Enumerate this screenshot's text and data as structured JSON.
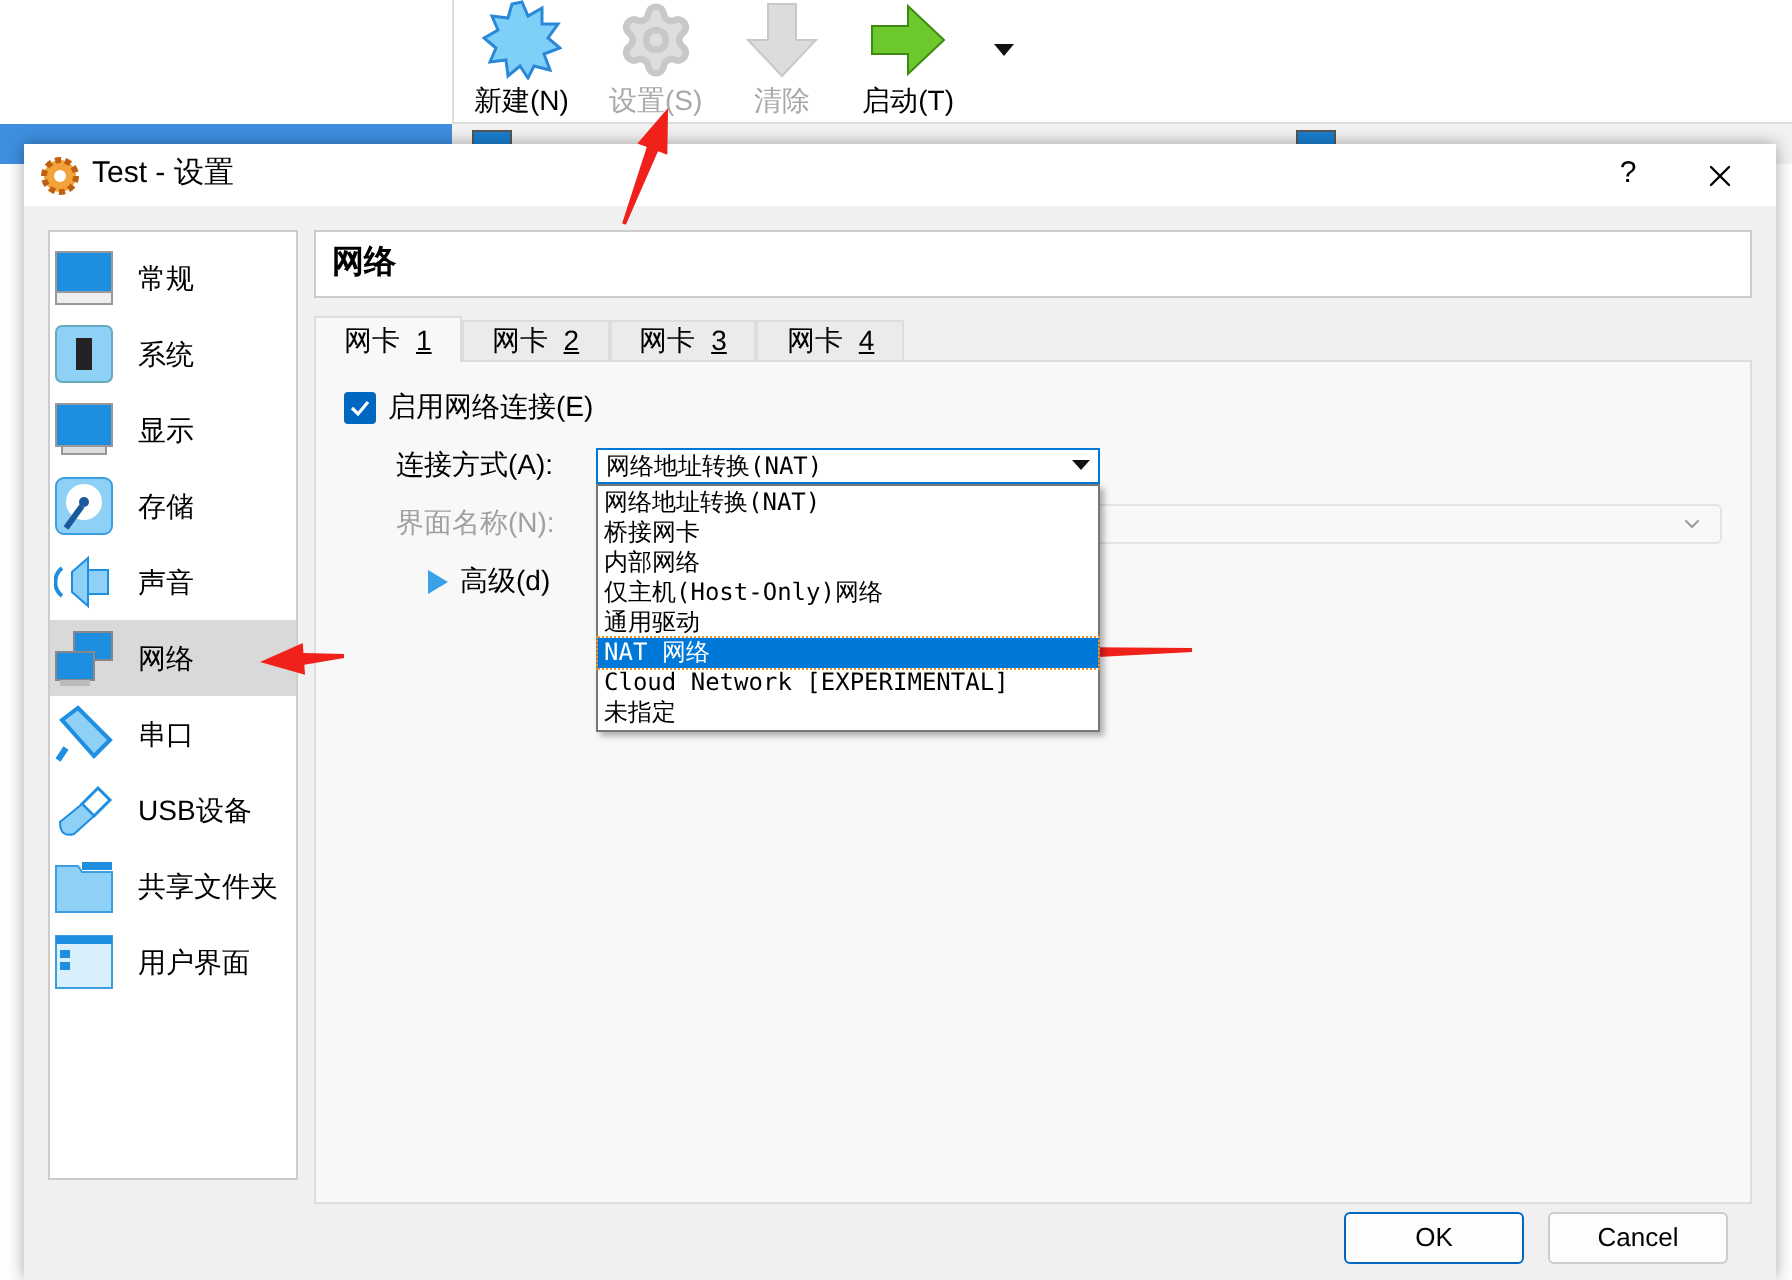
{
  "toolbar": {
    "buttons": [
      {
        "label": "新建(N)",
        "kind": "new",
        "disabled": false
      },
      {
        "label": "设置(S)",
        "kind": "settings",
        "disabled": true
      },
      {
        "label": "清除",
        "kind": "discard",
        "disabled": true
      },
      {
        "label": "启动(T)",
        "kind": "start",
        "disabled": false
      }
    ]
  },
  "dialog": {
    "title": "Test - 设置",
    "help": "?",
    "sidebar": {
      "items": [
        {
          "label": "常规",
          "kind": "general",
          "selected": false
        },
        {
          "label": "系统",
          "kind": "system",
          "selected": false
        },
        {
          "label": "显示",
          "kind": "display",
          "selected": false
        },
        {
          "label": "存储",
          "kind": "storage",
          "selected": false
        },
        {
          "label": "声音",
          "kind": "audio",
          "selected": false
        },
        {
          "label": "网络",
          "kind": "network",
          "selected": true
        },
        {
          "label": "串口",
          "kind": "serial",
          "selected": false
        },
        {
          "label": "USB设备",
          "kind": "usb",
          "selected": false
        },
        {
          "label": "共享文件夹",
          "kind": "folder",
          "selected": false
        },
        {
          "label": "用户界面",
          "kind": "ui",
          "selected": false
        }
      ]
    },
    "section_title": "网络",
    "tabs": [
      {
        "label": "网卡",
        "key": "1",
        "selected": true
      },
      {
        "label": "网卡",
        "key": "2",
        "selected": false
      },
      {
        "label": "网卡",
        "key": "3",
        "selected": false
      },
      {
        "label": "网卡",
        "key": "4",
        "selected": false
      }
    ],
    "enable_network": {
      "label": "启用网络连接(E)",
      "checked": true
    },
    "attached_to": {
      "label": "连接方式(A):",
      "value": "网络地址转换(NAT)",
      "expanded": true,
      "options": [
        {
          "label": "网络地址转换(NAT)",
          "highlighted": false
        },
        {
          "label": "桥接网卡",
          "highlighted": false
        },
        {
          "label": "内部网络",
          "highlighted": false
        },
        {
          "label": "仅主机(Host-Only)网络",
          "highlighted": false
        },
        {
          "label": "通用驱动",
          "highlighted": false
        },
        {
          "label": "NAT 网络",
          "highlighted": true
        },
        {
          "label": "Cloud Network [EXPERIMENTAL]",
          "highlighted": false
        },
        {
          "label": "未指定",
          "highlighted": false
        }
      ]
    },
    "interface_name": {
      "label": "界面名称(N):",
      "disabled": true
    },
    "advanced": {
      "label": "高级(d)",
      "expanded": false
    },
    "buttons": [
      {
        "label": "OK",
        "focused": true
      },
      {
        "label": "Cancel",
        "focused": false
      }
    ]
  }
}
